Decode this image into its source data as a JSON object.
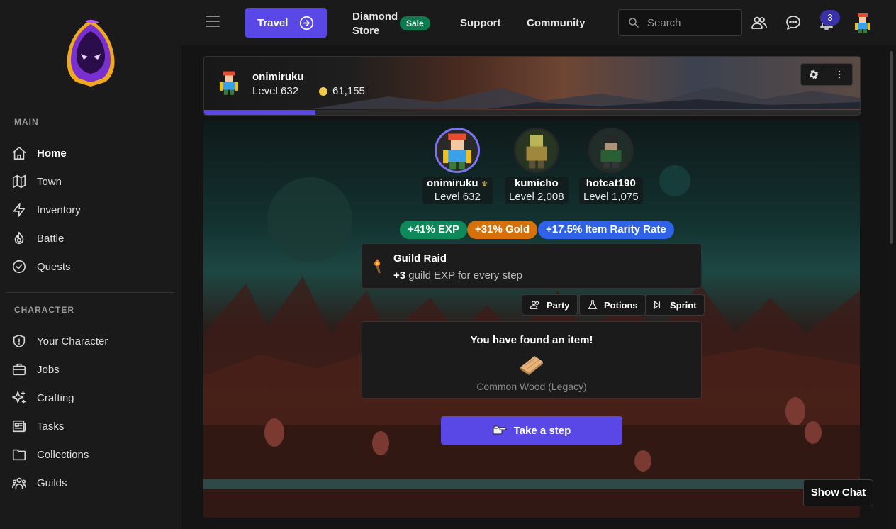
{
  "sidebar": {
    "main_section": "MAIN",
    "character_section": "CHARACTER",
    "main_items": [
      {
        "label": "Home",
        "icon": "home-icon"
      },
      {
        "label": "Town",
        "icon": "map-icon"
      },
      {
        "label": "Inventory",
        "icon": "lightning-icon"
      },
      {
        "label": "Battle",
        "icon": "flame-icon"
      },
      {
        "label": "Quests",
        "icon": "check-circle-icon"
      }
    ],
    "character_items": [
      {
        "label": "Your Character",
        "icon": "shield-icon"
      },
      {
        "label": "Jobs",
        "icon": "briefcase-icon"
      },
      {
        "label": "Crafting",
        "icon": "sparkles-icon"
      },
      {
        "label": "Tasks",
        "icon": "newspaper-icon"
      },
      {
        "label": "Collections",
        "icon": "folder-icon"
      },
      {
        "label": "Guilds",
        "icon": "users-icon"
      }
    ]
  },
  "topbar": {
    "travel_label": "Travel",
    "diamond_line1": "Diamond",
    "diamond_line2": "Store",
    "sale_label": "Sale",
    "support_label": "Support",
    "community_label": "Community",
    "search_placeholder": "Search",
    "notification_count": "3"
  },
  "profile": {
    "name": "onimiruku",
    "level": "Level 632",
    "gold": "61,155",
    "progress": 0.17
  },
  "party": [
    {
      "name": "onimiruku",
      "level": "Level 632",
      "crown": true
    },
    {
      "name": "kumicho",
      "level": "Level 2,008"
    },
    {
      "name": "hotcat190",
      "level": "Level 1,075"
    }
  ],
  "buffs": [
    {
      "label": "+41% EXP",
      "color": "#10895a"
    },
    {
      "label": "+31% Gold",
      "color": "#d6700a"
    },
    {
      "label": "+17.5% Item Rarity Rate",
      "color": "#2f62e6"
    }
  ],
  "raid": {
    "title": "Guild Raid",
    "bonus": "+3",
    "desc": "guild EXP for every step"
  },
  "actions": {
    "party": "Party",
    "potions": "Potions",
    "sprint": "Sprint"
  },
  "found": {
    "title": "You have found an item!",
    "item": "Common Wood (Legacy)"
  },
  "step_label": "Take a step",
  "show_chat": "Show Chat"
}
